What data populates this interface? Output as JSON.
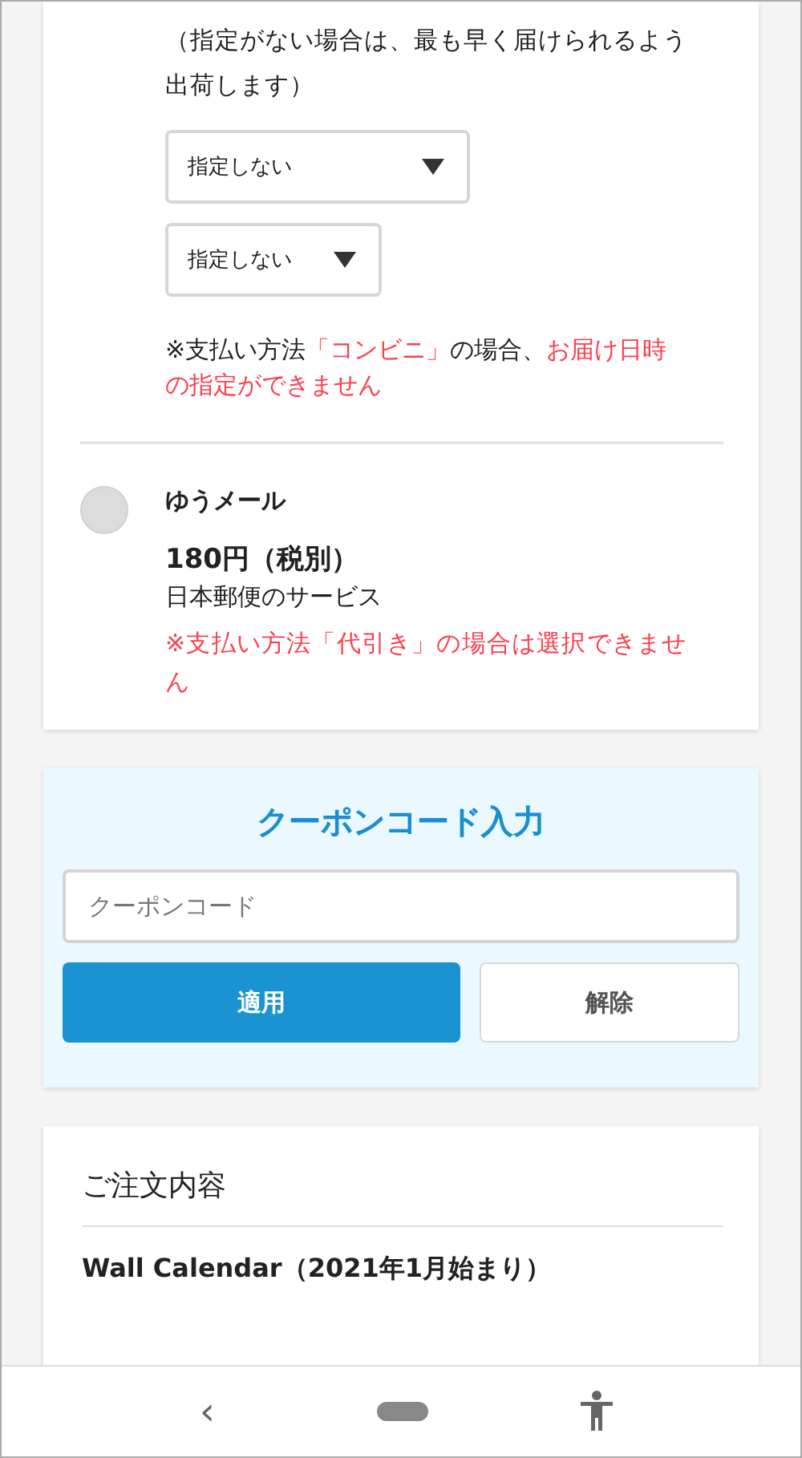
{
  "delivery_time": {
    "hint": "（指定がない場合は、最も早く届けられるよう出荷します）",
    "selects": [
      {
        "value": "指定しない"
      },
      {
        "value": "指定しない"
      }
    ],
    "note": [
      {
        "text": "※支払い方法",
        "alert": false
      },
      {
        "text": "「コンビニ」",
        "alert": true
      },
      {
        "text": "の場合、",
        "alert": false
      },
      {
        "text": "お届け日時の指定ができません",
        "alert": true
      }
    ]
  },
  "shipping_options": [
    {
      "name": "ゆうメール",
      "selected": false,
      "price": "180円（税別）",
      "description": "日本郵便のサービス",
      "warning": "※支払い方法「代引き」の場合は選択できません"
    }
  ],
  "coupon": {
    "title": "クーポンコード入力",
    "placeholder": "クーポンコード",
    "buttons": [
      {
        "label": "適用",
        "kind": "primary"
      },
      {
        "label": "解除",
        "kind": "secondary"
      }
    ]
  },
  "order": {
    "title": "ご注文内容",
    "items": [
      "Wall Calendar（2021年1月始まり）"
    ]
  },
  "nav_bar": {
    "back": "‹"
  }
}
